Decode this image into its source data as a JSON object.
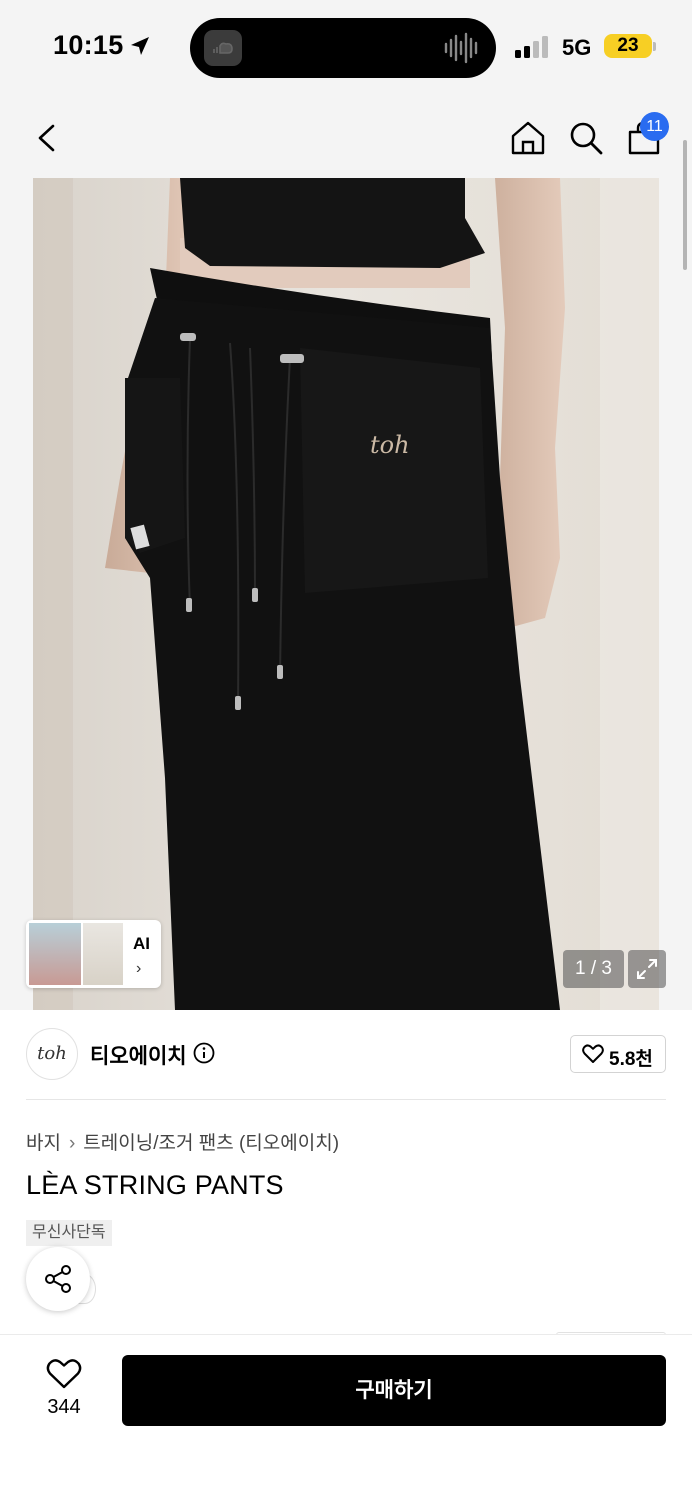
{
  "status_bar": {
    "time": "10:15",
    "network": "5G",
    "battery": "23"
  },
  "nav": {
    "cart_count": "11"
  },
  "gallery": {
    "ai_label": "AI",
    "ai_chevron": "›",
    "page_indicator": "1 / 3",
    "logo_text": "toh"
  },
  "brand": {
    "logo_text": "toh",
    "name": "티오에이치",
    "likes": "5.8천"
  },
  "product": {
    "breadcrumb": [
      "바지",
      "트레이닝/조거 팬츠 (티오에이치)"
    ],
    "breadcrumb_separator": "›",
    "title": "LÈA STRING PANTS",
    "badge": "무신사단독"
  },
  "bottom_bar": {
    "wish_count": "344",
    "buy_label": "구매하기"
  },
  "colors": {
    "accent_badge": "#2a6cf0",
    "battery": "#f7cf24",
    "buy_button": "#000000"
  }
}
